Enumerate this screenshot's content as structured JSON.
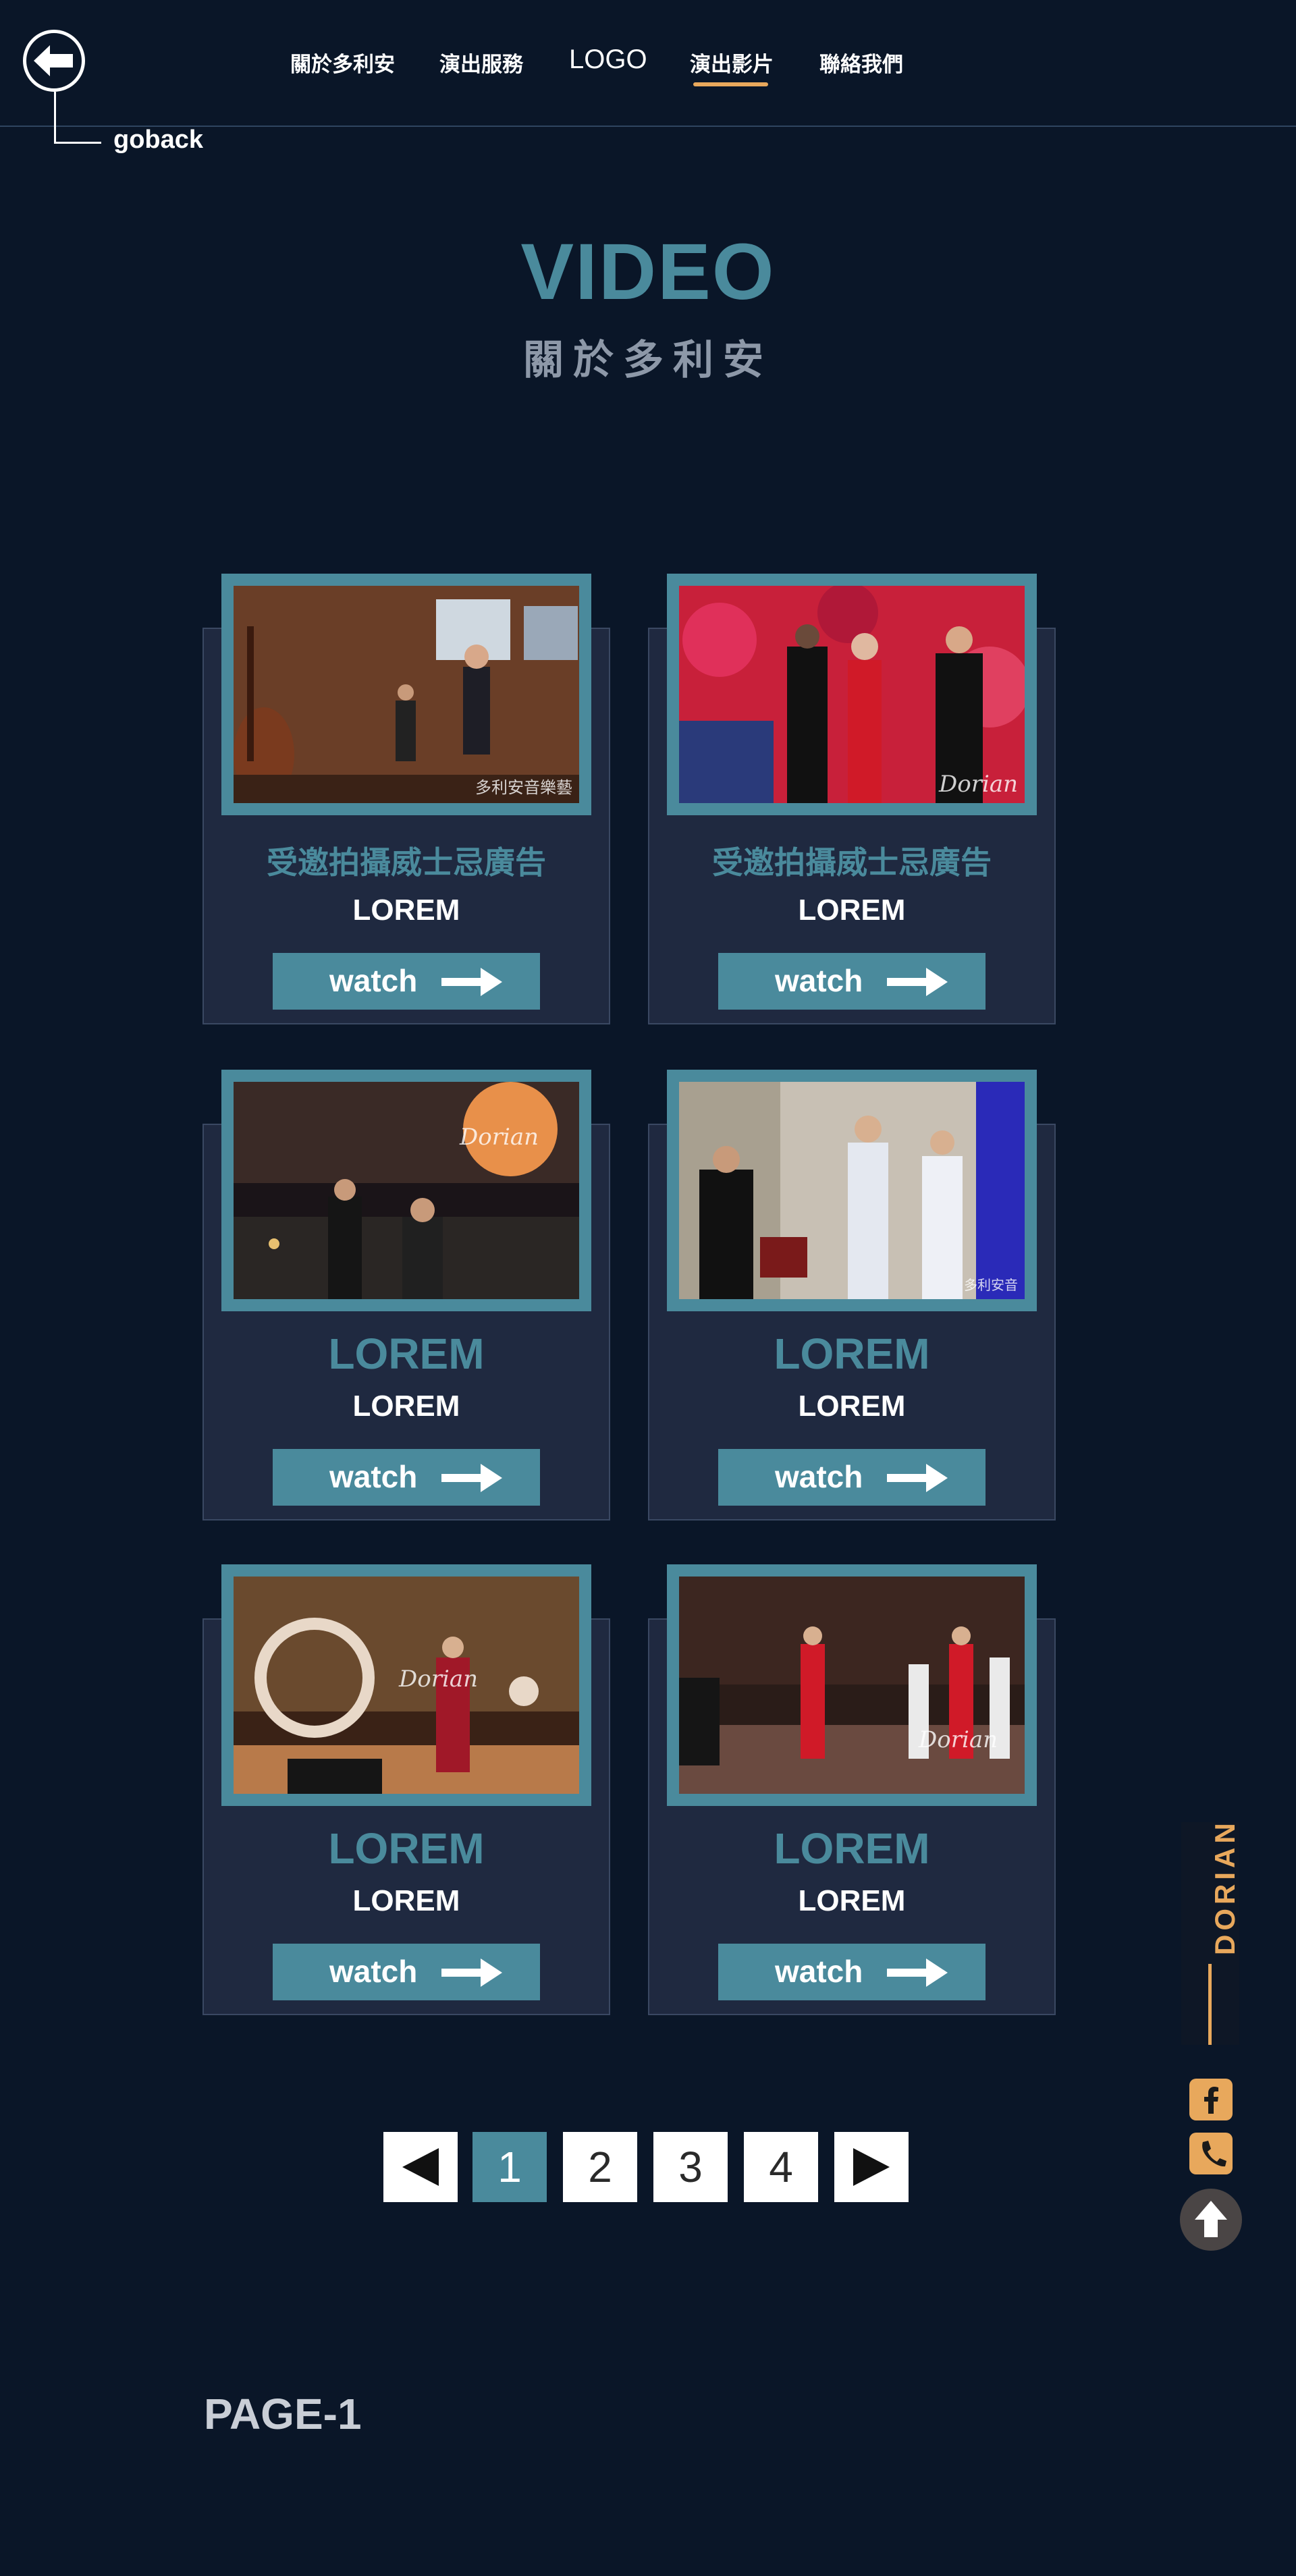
{
  "header": {
    "goback_label": "goback",
    "nav": [
      "關於多利安",
      "演出服務",
      "LOGO",
      "演出影片",
      "聯絡我們"
    ],
    "active_nav": "演出影片",
    "accent_color": "#e8a85c"
  },
  "hero": {
    "title_en": "VIDEO",
    "title_zh": "關於多利安"
  },
  "videos": [
    {
      "title": "受邀拍攝威士忌廣告",
      "subtitle": "LOREM",
      "button": "watch",
      "watermark": "多利安音樂藝"
    },
    {
      "title": "受邀拍攝威士忌廣告",
      "subtitle": "LOREM",
      "button": "watch",
      "watermark": "Dorian"
    },
    {
      "title": "LOREM",
      "subtitle": "LOREM",
      "button": "watch",
      "watermark": "Dorian"
    },
    {
      "title": "LOREM",
      "subtitle": "LOREM",
      "button": "watch",
      "watermark": "多利安音"
    },
    {
      "title": "LOREM",
      "subtitle": "LOREM",
      "button": "watch",
      "watermark": "Dorian"
    },
    {
      "title": "LOREM",
      "subtitle": "LOREM",
      "button": "watch",
      "watermark": "Dorian"
    }
  ],
  "pagination": {
    "pages": [
      "1",
      "2",
      "3",
      "4"
    ],
    "current": "1",
    "prev_icon": "triangle-left-icon",
    "next_icon": "triangle-right-icon"
  },
  "page_label": "PAGE-1",
  "side_widget": {
    "brand": "DORIAN",
    "icons": [
      "facebook-icon",
      "phone-icon",
      "arrow-up-icon"
    ]
  },
  "colors": {
    "background": "#0a1628",
    "teal": "#4a8a9c",
    "card": "#1f2940",
    "orange": "#e8a85c"
  }
}
